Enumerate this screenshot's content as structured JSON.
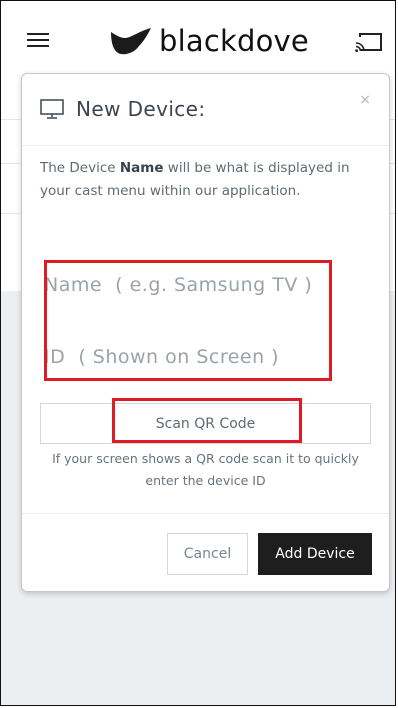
{
  "header": {
    "brand_name": "blackdove",
    "menu_icon": "hamburger-menu-icon",
    "logo_icon": "dove-logo-icon",
    "cast_icon": "cast-icon"
  },
  "modal": {
    "title": "New Device:",
    "title_icon": "monitor-icon",
    "close_label": "×",
    "description_prefix": "The Device ",
    "description_bold": "Name",
    "description_suffix": " will be what is displayed in your cast menu within our application.",
    "name_placeholder": "Name  ( e.g. Samsung TV )",
    "id_placeholder": "ID  ( Shown on Screen )",
    "scan_button_label": "Scan QR Code",
    "scan_hint": "If your screen shows a QR code scan it to quickly enter the device ID",
    "cancel_label": "Cancel",
    "add_label": "Add Device"
  },
  "colors": {
    "highlight": "#e01b24",
    "primary_button": "#1e1e1e",
    "dim_background": "#eceff1"
  }
}
